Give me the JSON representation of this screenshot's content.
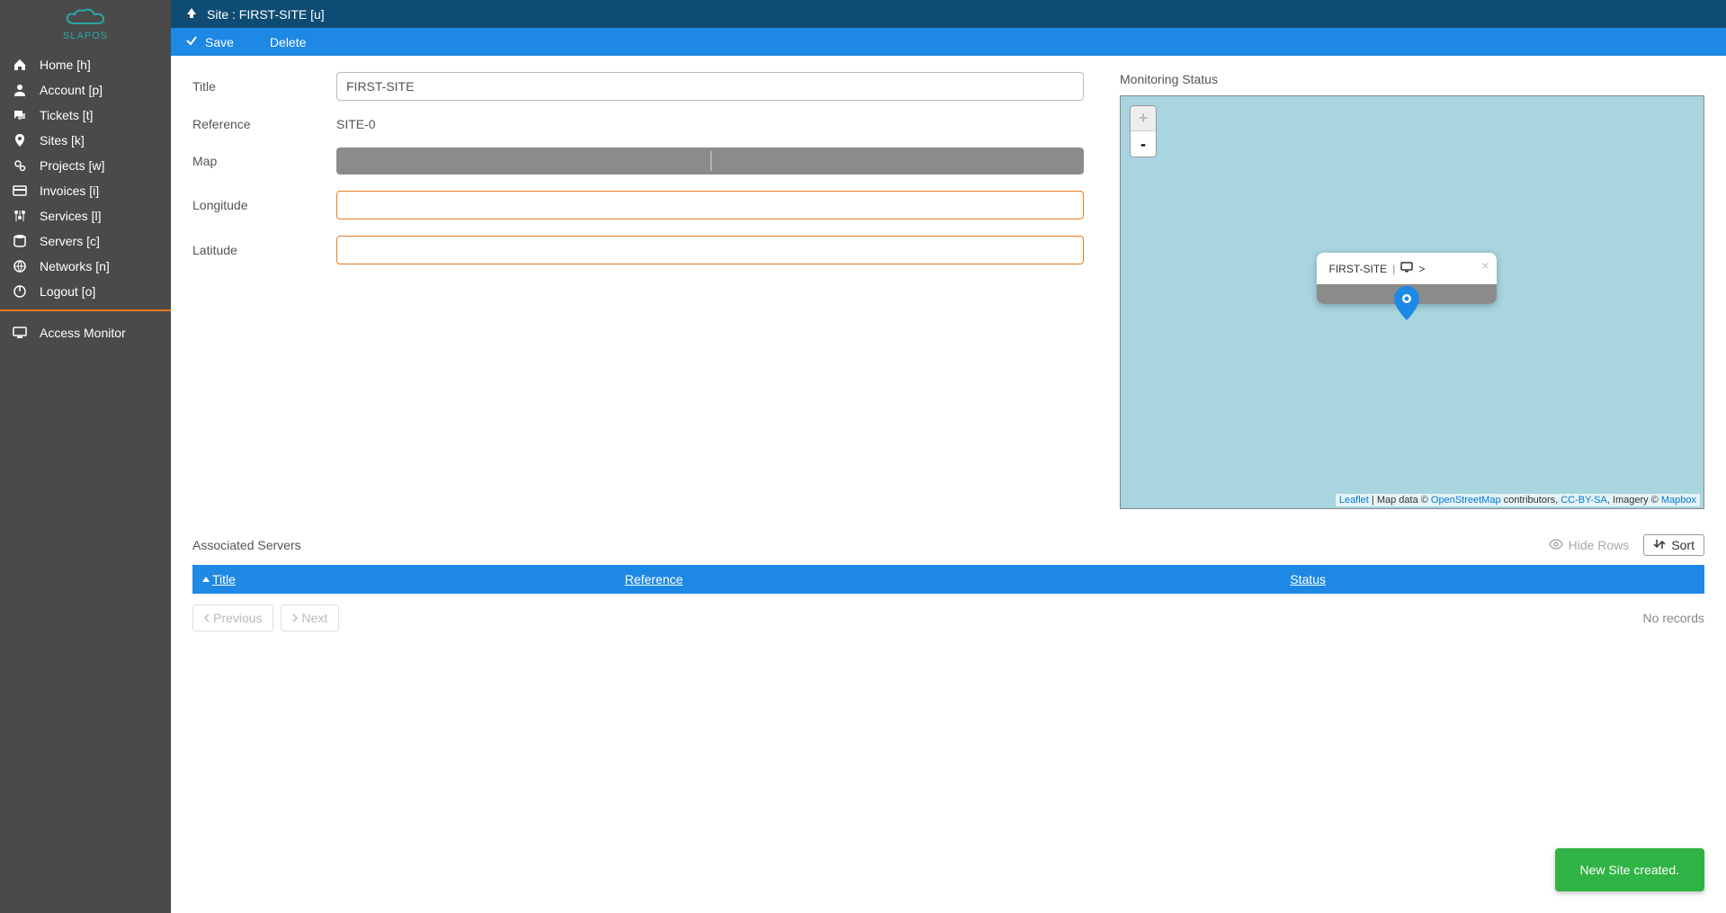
{
  "brand": "SLAPOS",
  "header": {
    "title": "Site : FIRST-SITE [u]"
  },
  "actions": {
    "save": "Save",
    "delete": "Delete"
  },
  "sidebar": {
    "items": [
      {
        "icon": "home",
        "label": "Home [h]"
      },
      {
        "icon": "user",
        "label": "Account [p]"
      },
      {
        "icon": "comments",
        "label": "Tickets [t]"
      },
      {
        "icon": "pin",
        "label": "Sites [k]"
      },
      {
        "icon": "cogs",
        "label": "Projects [w]"
      },
      {
        "icon": "card",
        "label": "Invoices [i]"
      },
      {
        "icon": "sliders",
        "label": "Services [l]"
      },
      {
        "icon": "db",
        "label": "Servers [c]"
      },
      {
        "icon": "globe",
        "label": "Networks [n]"
      },
      {
        "icon": "power",
        "label": "Logout [o]"
      }
    ],
    "monitor": {
      "icon": "monitor",
      "label": "Access Monitor"
    }
  },
  "form": {
    "title_label": "Title",
    "title_value": "FIRST-SITE",
    "reference_label": "Reference",
    "reference_value": "SITE-0",
    "map_label": "Map",
    "longitude_label": "Longitude",
    "longitude_value": "",
    "latitude_label": "Latitude",
    "latitude_value": ""
  },
  "monitoring": {
    "label": "Monitoring Status",
    "popup_title": "FIRST-SITE",
    "popup_sep": "|",
    "popup_arrow": ">",
    "zoom_in": "+",
    "zoom_out": "-",
    "attrib": {
      "leaflet": "Leaflet",
      "sep1": " | Map data © ",
      "osm": "OpenStreetMap",
      "contrib": " contributors, ",
      "cc": "CC-BY-SA",
      "imagery": ", Imagery © ",
      "mapbox": "Mapbox"
    }
  },
  "servers": {
    "title": "Associated Servers",
    "hide_rows": "Hide Rows",
    "sort": "Sort",
    "columns": {
      "title": "Title",
      "reference": "Reference",
      "status": "Status"
    },
    "prev": "Previous",
    "next": "Next",
    "no_records": "No records"
  },
  "toast": "New Site created."
}
